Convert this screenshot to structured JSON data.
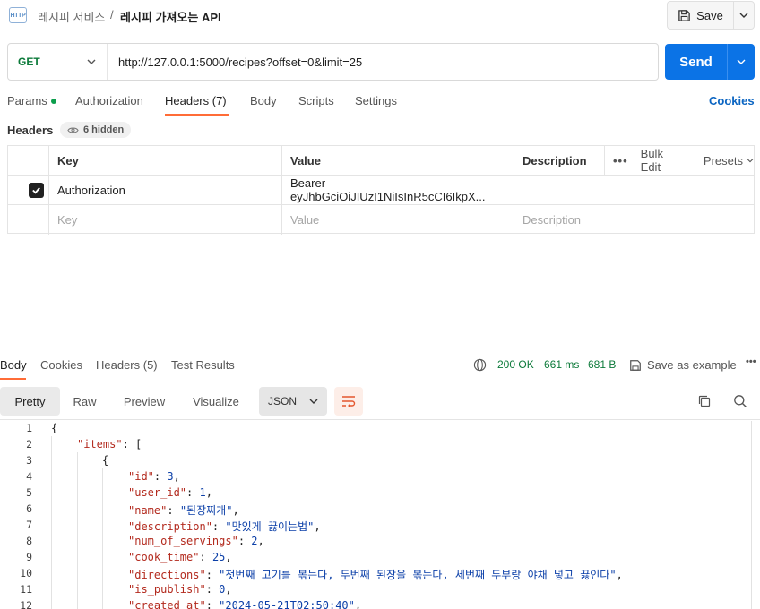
{
  "breadcrumb": {
    "parent": "레시피 서비스",
    "separator": "/",
    "current": "레시피 가져오는 API"
  },
  "save": {
    "label": "Save"
  },
  "request": {
    "method": "GET",
    "url": "http://127.0.0.1:5000/recipes?offset=0&limit=25",
    "send_label": "Send"
  },
  "request_tabs": [
    "Params",
    "Authorization",
    "Headers (7)",
    "Body",
    "Scripts",
    "Settings"
  ],
  "cookies_label": "Cookies",
  "headers_section": {
    "title": "Headers",
    "hidden": "6 hidden"
  },
  "headers_table": {
    "columns": {
      "key": "Key",
      "value": "Value",
      "description": "Description"
    },
    "bulk_edit": "Bulk Edit",
    "presets": "Presets",
    "rows": [
      {
        "key": "Authorization",
        "value": "Bearer eyJhbGciOiJIUzI1NiIsInR5cCI6IkpX...",
        "description": ""
      }
    ],
    "placeholder": {
      "key": "Key",
      "value": "Value",
      "description": "Description"
    }
  },
  "response_tabs": [
    "Body",
    "Cookies",
    "Headers (5)",
    "Test Results"
  ],
  "response_status": {
    "status": "200 OK",
    "time": "661 ms",
    "size": "681 B",
    "save_example": "Save as example"
  },
  "format_tabs": [
    "Pretty",
    "Raw",
    "Preview",
    "Visualize"
  ],
  "format_select": "JSON",
  "code_lines": [
    {
      "n": "1"
    },
    {
      "n": "2",
      "key": "\"items\"",
      "rest": ": ["
    },
    {
      "n": "3"
    },
    {
      "n": "4",
      "key": "\"id\"",
      "sep": ": ",
      "val": "3",
      "end": ","
    },
    {
      "n": "5",
      "key": "\"user_id\"",
      "sep": ": ",
      "val": "1",
      "end": ","
    },
    {
      "n": "6",
      "key": "\"name\"",
      "sep": ": ",
      "val": "\"된장찌개\"",
      "end": ","
    },
    {
      "n": "7",
      "key": "\"description\"",
      "sep": ": ",
      "val": "\"맛있게 끓이는법\"",
      "end": ","
    },
    {
      "n": "8",
      "key": "\"num_of_servings\"",
      "sep": ": ",
      "val": "2",
      "end": ","
    },
    {
      "n": "9",
      "key": "\"cook_time\"",
      "sep": ": ",
      "val": "25",
      "end": ","
    },
    {
      "n": "10",
      "key": "\"directions\"",
      "sep": ": ",
      "val": "\"첫번째 고기를 볶는다, 두번째 된장을 볶는다, 세번째 두부랑 야채 넣고 끓인다\"",
      "end": ","
    },
    {
      "n": "11",
      "key": "\"is_publish\"",
      "sep": ": ",
      "val": "0",
      "end": ","
    },
    {
      "n": "12",
      "key": "\"created_at\"",
      "sep": ": ",
      "val": "\"2024-05-21T02:50:40\"",
      "end": ","
    }
  ],
  "code_braces": {
    "open": "{",
    "item_open": "{"
  },
  "colors": {
    "accent": "#ff6c37",
    "send": "#0b73e6",
    "method": "#0c7a3a",
    "json_key": "#b32a1e",
    "json_value": "#0b3fa8"
  }
}
